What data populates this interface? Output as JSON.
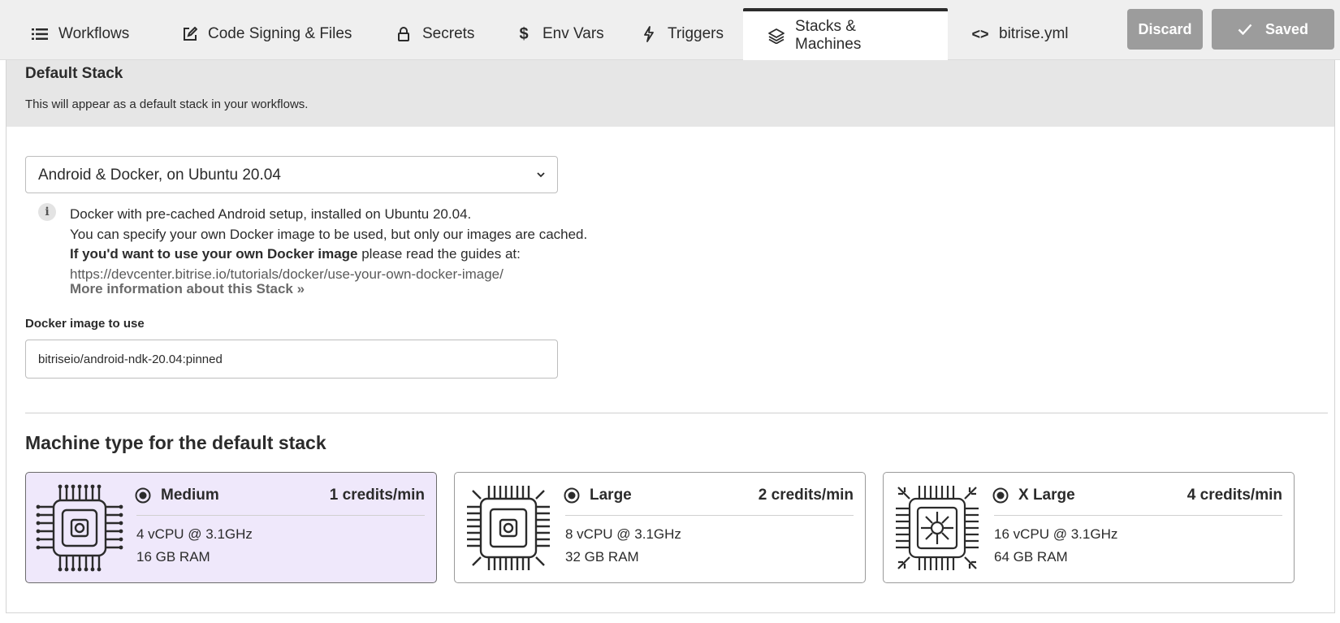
{
  "tabs": [
    {
      "label": "Workflows",
      "icon": "list-icon"
    },
    {
      "label": "Code Signing & Files",
      "icon": "edit-icon"
    },
    {
      "label": "Secrets",
      "icon": "lock-icon"
    },
    {
      "label": "Env Vars",
      "icon": "dollar-icon"
    },
    {
      "label": "Triggers",
      "icon": "lightning-icon"
    },
    {
      "label": "Stacks & Machines",
      "icon": "layers-icon",
      "active": true
    },
    {
      "label": "bitrise.yml",
      "icon": "code-icon"
    }
  ],
  "actions": {
    "discard_label": "Discard",
    "saved_label": "Saved"
  },
  "default_stack": {
    "title": "Default Stack",
    "subtitle": "This will appear as a default stack in your workflows.",
    "selected": "Android & Docker, on Ubuntu 20.04",
    "info": {
      "line1": "Docker with pre-cached Android setup, installed on Ubuntu 20.04.",
      "line2": "You can specify your own Docker image to be used, but only our images are cached.",
      "line3_bold": "If you'd want to use your own Docker image",
      "line3_rest": " please read the guides at:",
      "link": "https://devcenter.bitrise.io/tutorials/docker/use-your-own-docker-image/",
      "more": "More information about this Stack »"
    }
  },
  "docker": {
    "label": "Docker image to use",
    "value": "bitriseio/android-ndk-20.04:pinned"
  },
  "machines": {
    "title": "Machine type for the default stack",
    "items": [
      {
        "name": "Medium",
        "credits": "1 credits/min",
        "cpu": "4 vCPU @ 3.1GHz",
        "ram": "16 GB RAM",
        "selected": true
      },
      {
        "name": "Large",
        "credits": "2 credits/min",
        "cpu": "8 vCPU @ 3.1GHz",
        "ram": "32 GB RAM",
        "selected": false
      },
      {
        "name": "X Large",
        "credits": "4 credits/min",
        "cpu": "16 vCPU @ 3.1GHz",
        "ram": "64 GB RAM",
        "selected": false
      }
    ]
  },
  "colors": {
    "selected_card_bg": "#efe8fb",
    "button_bg": "#9c9c9c",
    "header_bg": "#e6e6e6"
  }
}
